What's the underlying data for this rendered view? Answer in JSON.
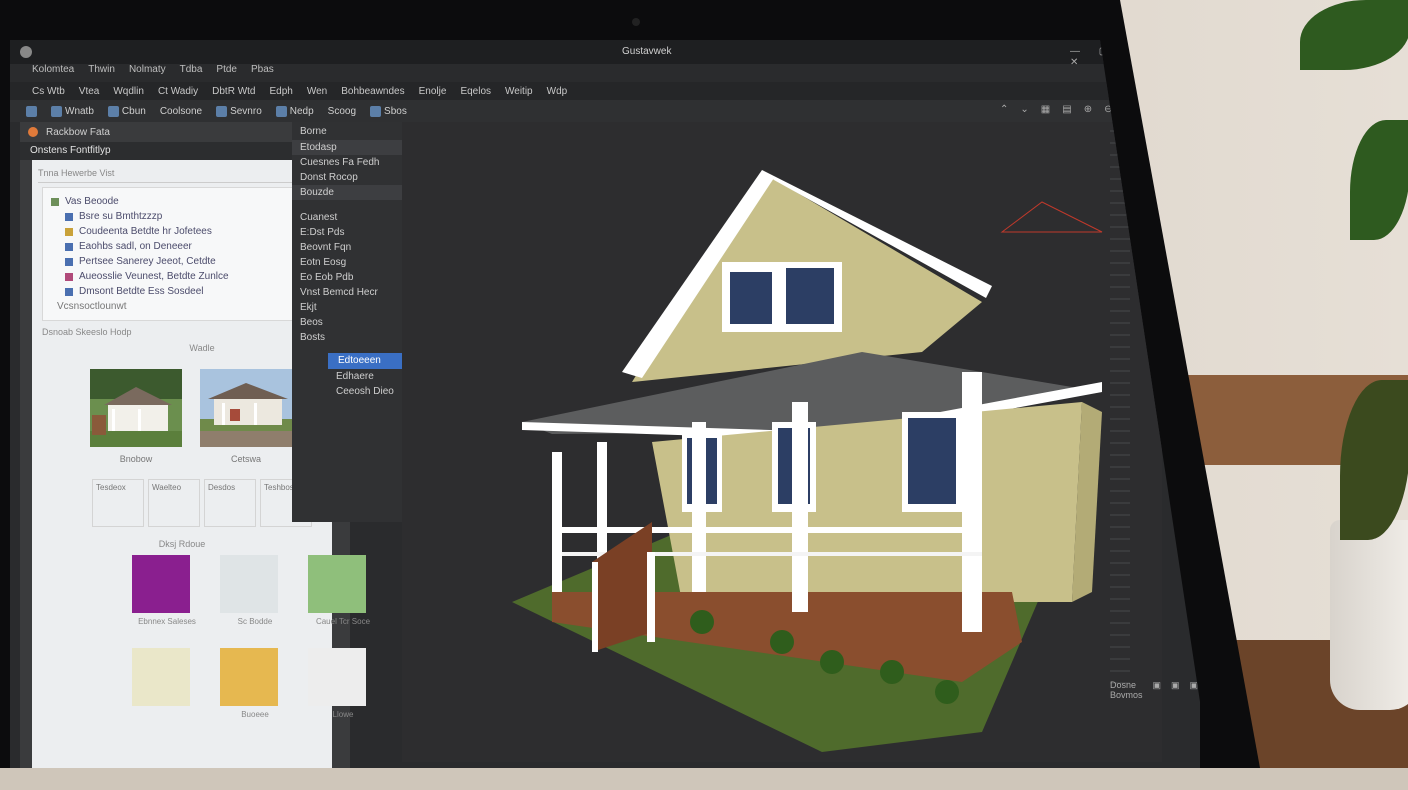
{
  "window": {
    "title": "Gustavwek"
  },
  "menu_top": [
    "Kolomtea",
    "Thwin",
    "Nolmaty",
    "Tdba",
    "Ptde",
    "Pbas"
  ],
  "menubar": [
    "Cs Wtb",
    "Vtea",
    "Wqdlin",
    "Ct Wadiy",
    "DbtR Wtd",
    "Edph",
    "Wen",
    "Bohbeawndes",
    "Enolje",
    "Eqelos",
    "Weitip",
    "Wdp"
  ],
  "toolbar": {
    "items": [
      "Wnatb",
      "Cbun",
      "Coolsone",
      "Sevnro",
      "Nedp",
      "Scoog",
      "Sbos"
    ],
    "right_icons": [
      "⌃",
      "⌄",
      "▦",
      "▤",
      "⊕",
      "⊖",
      "≡"
    ]
  },
  "left_panel": {
    "header": "Rackbow Fata",
    "subheader": "Onstens Fontfitlyp",
    "search_placeholder": "Tnna Hewerbe Vist",
    "tree_title": "Vas Beoode",
    "tree_items": [
      "Bsre su Bmthtzzzp",
      "Coudeenta Betdte hr Jofetees",
      "Eaohbs sadl, on Deneeer",
      "Pertsee Sanerey Jeeot, Cetdte",
      "Aueosslie Veunest, Betdte Zunlce",
      "Dmsont Betdte Ess Sosdeel"
    ],
    "tree_footer": "Vcsnsoctlounwt",
    "filter": "Dsnoab Skeeslo Hodp",
    "thumb_section": "Wadle",
    "thumbs": [
      {
        "caption": "Bnobow"
      },
      {
        "caption": "Cetswa"
      }
    ],
    "options": [
      "Tesdeox",
      "Waelteo",
      "Desdos",
      "Teshboss"
    ],
    "swatch_section": "Dksj Rdoue",
    "swatches": [
      {
        "label": "Ebnnex Saleses",
        "color": "#8a1f8f"
      },
      {
        "label": "Sc Bodde",
        "color": "#dfe4e6"
      },
      {
        "label": "Cauel Tcr Soce",
        "color": "#8fbf7b"
      },
      {
        "label": "",
        "color": "#eae7c9"
      },
      {
        "label": "Buoeee",
        "color": "#e6b850"
      },
      {
        "label": "Llowe",
        "color": "#ededed"
      }
    ]
  },
  "mid_panel": {
    "title": "Borne",
    "rows": [
      "Etodasp",
      "Cuesnes Fa Fedh",
      "Donst Rocop",
      "Bouzde"
    ],
    "group_title": "Cuanest",
    "group_rows": [
      "E:Dst Pds",
      "Beovnt Fqn",
      "Eotn Eosg",
      "Eo Eob Pdb",
      "Vnst Bemcd Hecr",
      "Ekjt",
      "Beos",
      "Bosts"
    ],
    "selected": "Edtoeeen",
    "item_a": "Edhaere",
    "item_b": "Ceeosh Dieo"
  },
  "status": [
    "Dosne Bovmos",
    "▣",
    "▣",
    "▣",
    "▣",
    "▣"
  ]
}
